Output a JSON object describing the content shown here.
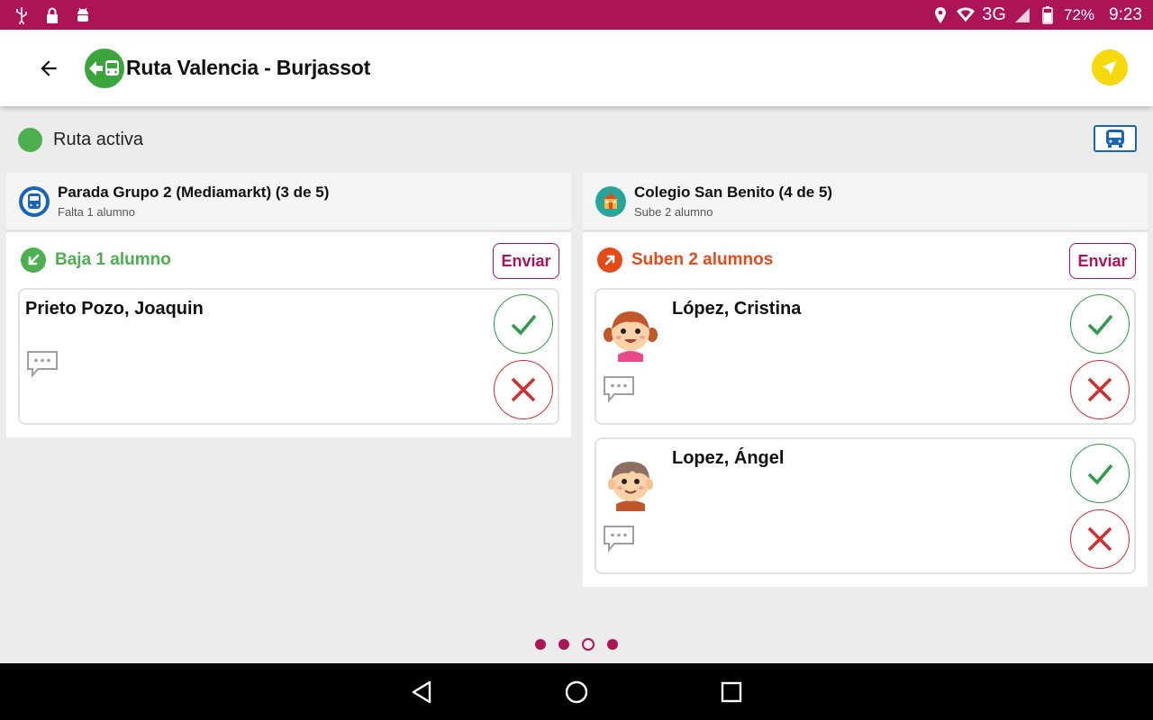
{
  "status_bar": {
    "battery": "72%",
    "time": "9:23",
    "network": "3G"
  },
  "app_bar": {
    "title": "Ruta Valencia - Burjassot"
  },
  "route_status": {
    "label": "Ruta activa",
    "color": "#4caf50"
  },
  "panels": [
    {
      "title": "Parada Grupo 2 (Mediamarkt) (3 de 5)",
      "subtitle": "Falta 1 alumno",
      "section_title": "Baja 1 alumno",
      "section_color": "#4caf50",
      "send_label": "Enviar",
      "students": [
        {
          "name": "Prieto Pozo, Joaquin"
        }
      ]
    },
    {
      "title": "Colegio San Benito (4 de 5)",
      "subtitle": "Sube 2 alumno",
      "section_title": "Suben 2 alumnos",
      "section_color": "#e64a19",
      "send_label": "Enviar",
      "students": [
        {
          "name": "López, Cristina"
        },
        {
          "name": "Lopez, Ángel"
        }
      ]
    }
  ],
  "pager": {
    "pages": 4,
    "current": 3
  },
  "colors": {
    "primary": "#ad1457",
    "accept": "#2e9d4a",
    "reject": "#d32f2f",
    "nav_button": "#f5d90a"
  }
}
